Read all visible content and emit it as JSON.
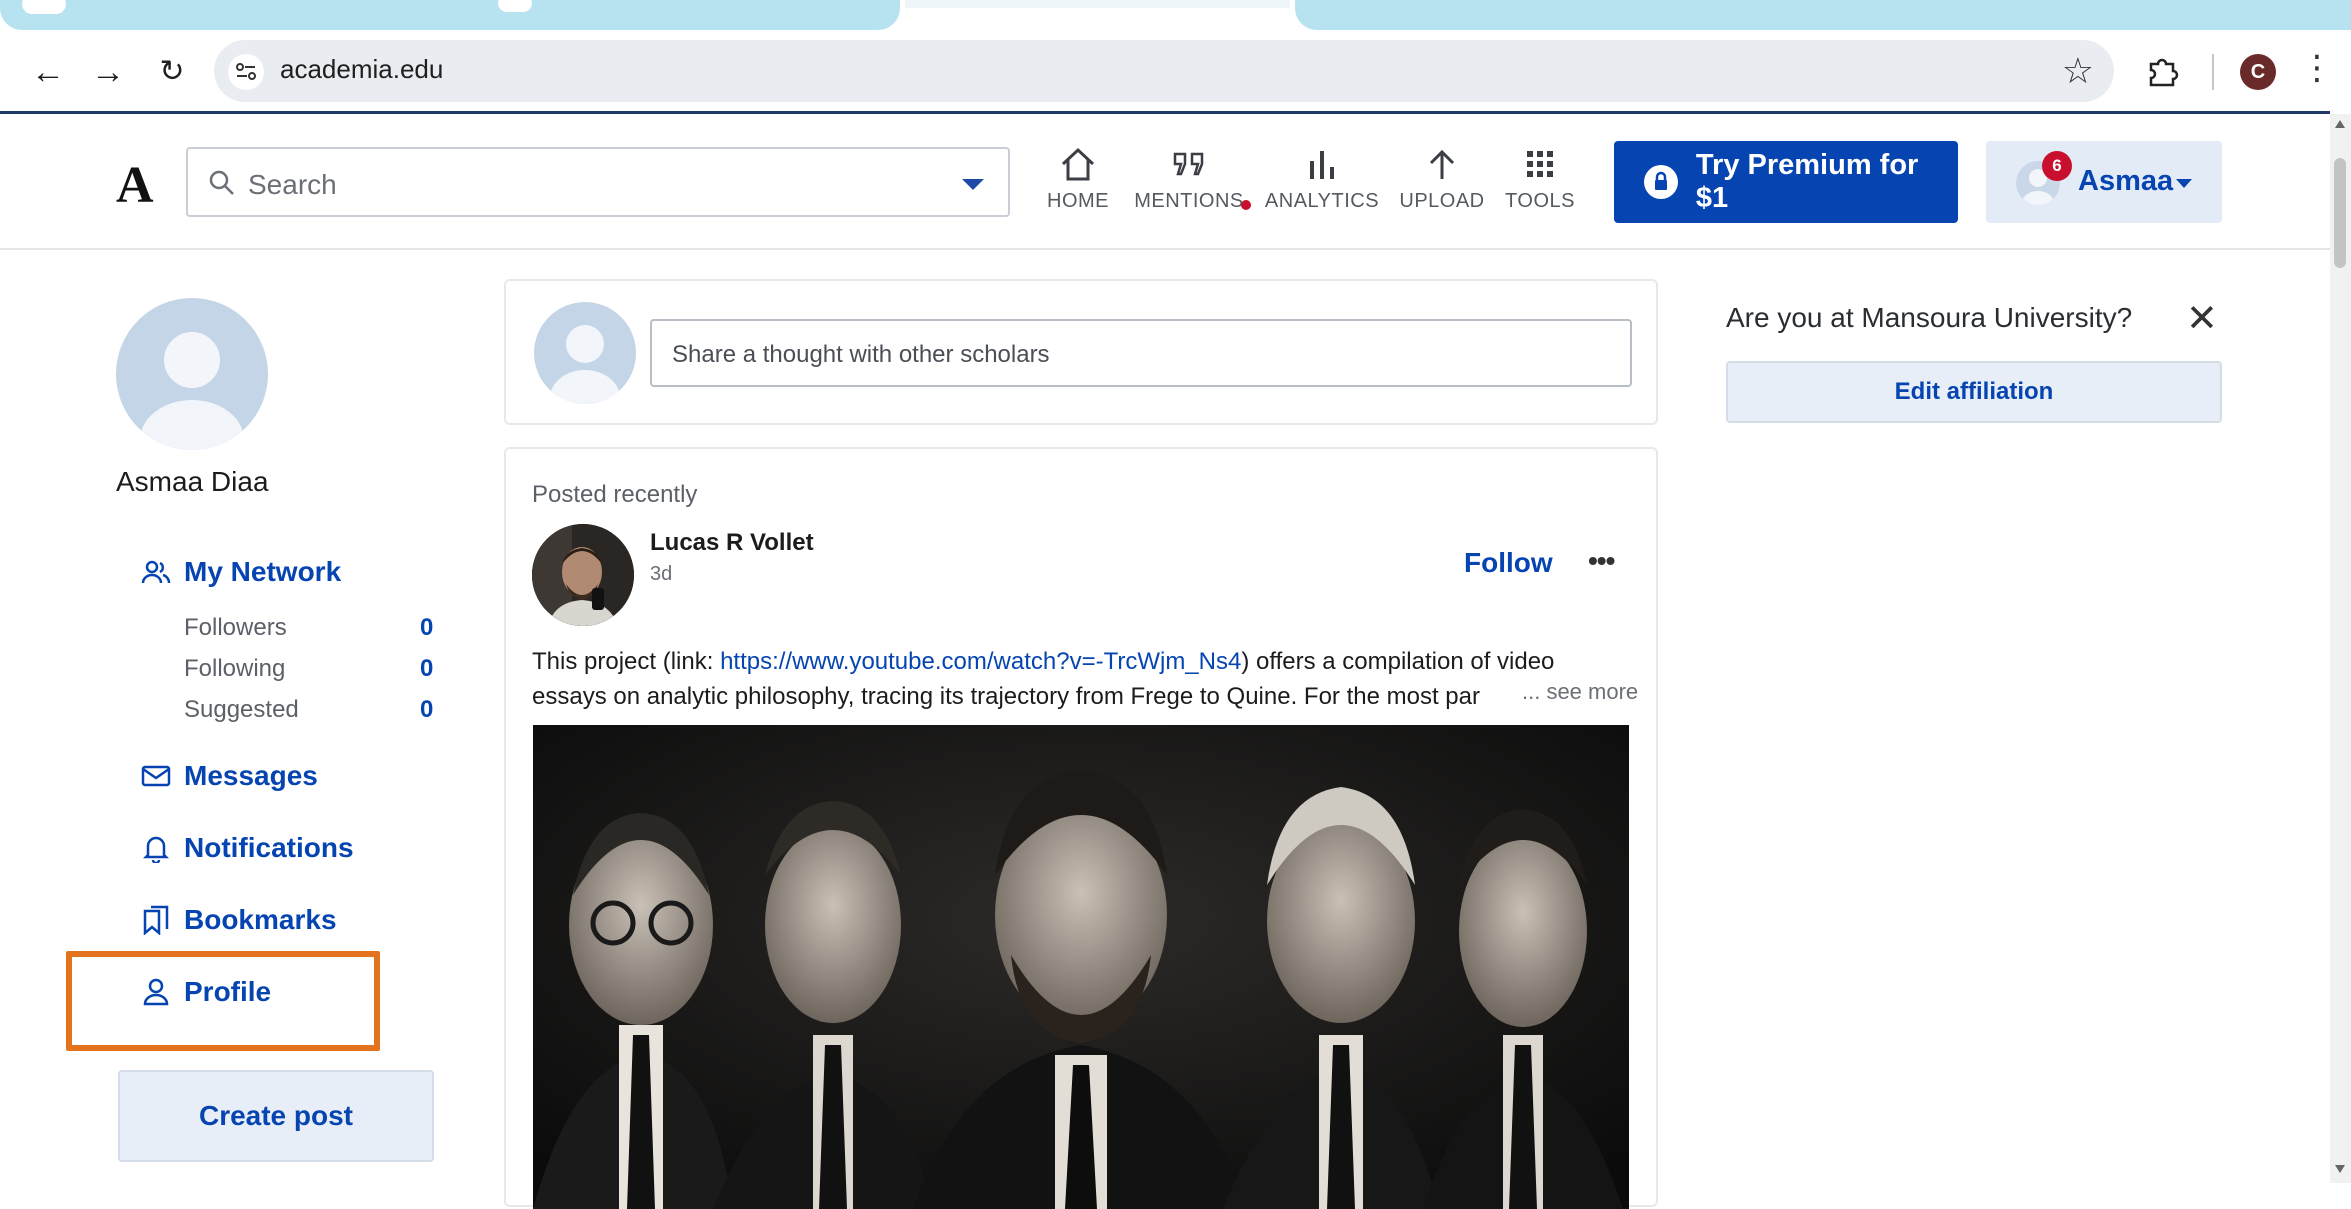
{
  "browser": {
    "url": "academia.edu",
    "profile_initial": "C",
    "accent": "#b6e3ef"
  },
  "header": {
    "logo": "A",
    "search_placeholder": "Search",
    "nav": [
      {
        "label": "HOME",
        "icon": "home-icon"
      },
      {
        "label": "MENTIONS",
        "icon": "quote-icon"
      },
      {
        "label": "ANALYTICS",
        "icon": "bar-chart-icon"
      },
      {
        "label": "UPLOAD",
        "icon": "upload-arrow-icon"
      },
      {
        "label": "TOOLS",
        "icon": "grid-icon"
      }
    ],
    "premium_label": "Try Premium for $1",
    "user_name": "Asmaa",
    "notification_count": "6",
    "brand_color": "#0645b1"
  },
  "sidebar": {
    "name": "Asmaa Diaa",
    "network_label": "My Network",
    "stats": [
      {
        "label": "Followers",
        "value": "0"
      },
      {
        "label": "Following",
        "value": "0"
      },
      {
        "label": "Suggested",
        "value": "0"
      }
    ],
    "links": [
      {
        "label": "Messages",
        "icon": "envelope-icon"
      },
      {
        "label": "Notifications",
        "icon": "bell-icon"
      },
      {
        "label": "Bookmarks",
        "icon": "bookmarks-icon"
      },
      {
        "label": "Profile",
        "icon": "person-icon"
      }
    ],
    "create_post": "Create post",
    "highlight_color": "#e3731c"
  },
  "feed": {
    "share_placeholder": "Share a thought with other scholars",
    "post": {
      "kicker": "Posted recently",
      "author": "Lucas R Vollet",
      "time": "3d",
      "follow_label": "Follow",
      "text_before_link": "This project (link: ",
      "link": "https://www.youtube.com/watch?v=-TrcWjm_Ns4",
      "text_after_link": ") offers a compilation of video essays on analytic philosophy, tracing its trajectory from Frege to Quine. For the most par",
      "see_more": "... see more"
    }
  },
  "right": {
    "affiliation_question": "Are you at Mansoura University?",
    "edit_affiliation": "Edit affiliation"
  }
}
